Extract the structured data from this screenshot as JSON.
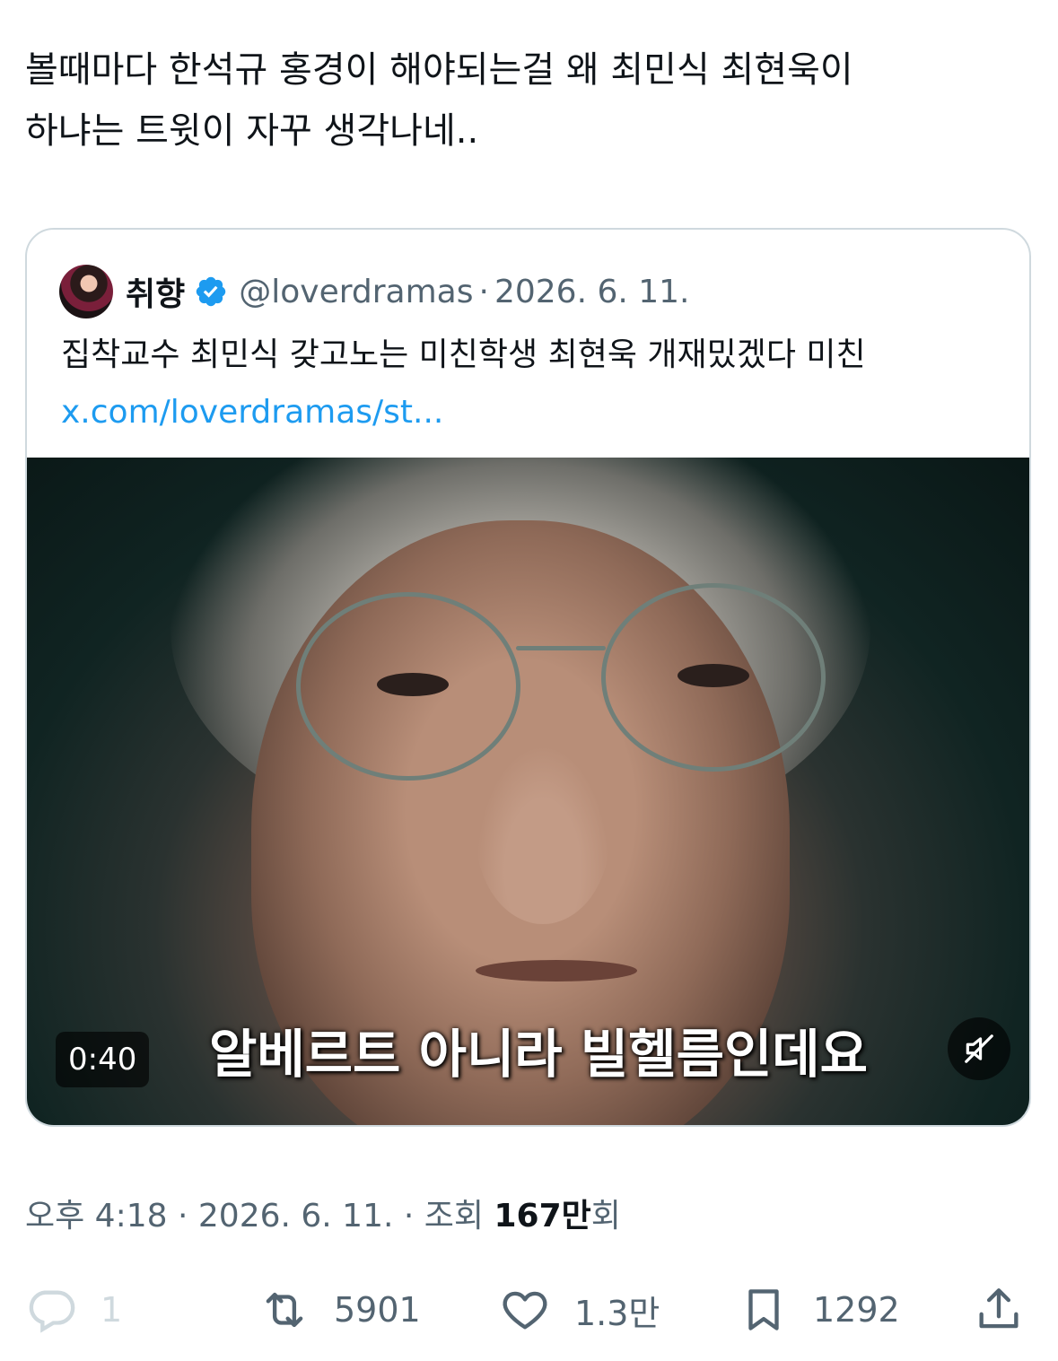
{
  "tweet": {
    "text": "볼때마다 한석규 홍경이 해야되는걸 왜 최민식 최현욱이\n하냐는 트윗이 자꾸 생각나네.."
  },
  "quote": {
    "display_name": "취향",
    "handle": "@loverdramas",
    "separator": "·",
    "date": "2026. 6. 11.",
    "text": "집착교수 최민식 갖고노는 미친학생 최현욱 개재밌겠다 미친",
    "link": "x.com/loverdramas/st...",
    "video": {
      "time": "0:40",
      "subtitle": "알베르트 아니라 빌헬름인데요",
      "mute_icon": "speaker-muted-icon"
    }
  },
  "meta": {
    "time": "오후 4:18",
    "sep1": "·",
    "date": "2026. 6. 11.",
    "sep2": "·",
    "views_label": "조회",
    "views_count": "167만",
    "views_suffix": "회"
  },
  "actions": {
    "reply_count": "1",
    "retweet_count": "5901",
    "like_count": "1.3만",
    "bookmark_count": "1292",
    "icons": [
      "reply-icon",
      "retweet-icon",
      "like-icon",
      "bookmark-icon",
      "share-icon"
    ]
  },
  "colors": {
    "text": "#0f1419",
    "secondary": "#536471",
    "link": "#1d9bf0",
    "verified": "#1d9bf0",
    "border": "#cfd9de"
  }
}
